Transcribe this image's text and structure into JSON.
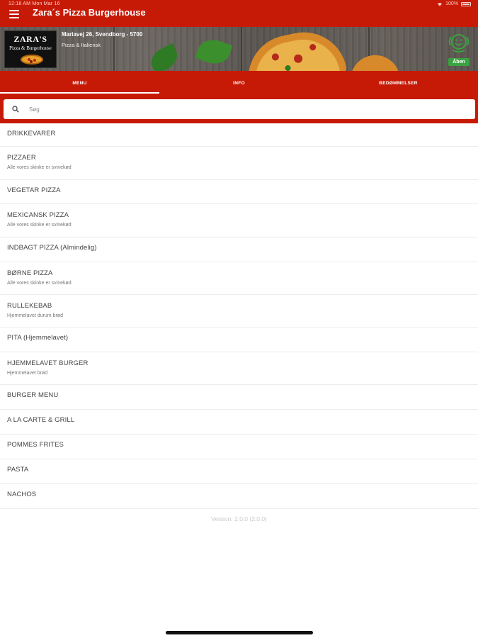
{
  "status_bar": {
    "left": "12:18 AM  Mon Mar 16",
    "right": "100%"
  },
  "app": {
    "title": "Zara´s Pizza Burgerhouse"
  },
  "restaurant": {
    "logo_name": "ZARA'S",
    "logo_sub": "Pizza & Burgerhouse",
    "address": "Mariavej 26, Svendborg - 5700",
    "cuisine": "Pizza & Italiensk",
    "open_status": "Åben",
    "open_color": "#3aa341"
  },
  "tabs": [
    {
      "label": "MENU",
      "active": true
    },
    {
      "label": "INFO",
      "active": false
    },
    {
      "label": "BEDØMMELSER",
      "active": false
    }
  ],
  "search": {
    "placeholder": "Søg",
    "value": ""
  },
  "menu": [
    {
      "name": "DRIKKEVARER",
      "desc": ""
    },
    {
      "name": "PIZZAER",
      "desc": "Alle vores skinke er svinekød"
    },
    {
      "name": "VEGETAR PIZZA",
      "desc": ""
    },
    {
      "name": "MEXICANSK PIZZA",
      "desc": "Alle vores skinke er svinekød"
    },
    {
      "name": "INDBAGT PIZZA (Almindelig)",
      "desc": ""
    },
    {
      "name": "BØRNE PIZZA",
      "desc": "Alle vores skinke er svinekød"
    },
    {
      "name": "RULLEKEBAB",
      "desc": "Hjemmelavet durum brød"
    },
    {
      "name": "PITA (Hjemmelavet)",
      "desc": ""
    },
    {
      "name": "HJEMMELAVET BURGER",
      "desc": "Hjemmelavet brød"
    },
    {
      "name": "BURGER MENU",
      "desc": ""
    },
    {
      "name": "A LA CARTE & GRILL",
      "desc": ""
    },
    {
      "name": "POMMES FRITES",
      "desc": ""
    },
    {
      "name": "PASTA",
      "desc": ""
    },
    {
      "name": "NACHOS",
      "desc": ""
    }
  ],
  "version": "Version: 2.0.0 (2.0.0)",
  "colors": {
    "brand": "#c71a06",
    "open_badge": "#3aa341"
  }
}
